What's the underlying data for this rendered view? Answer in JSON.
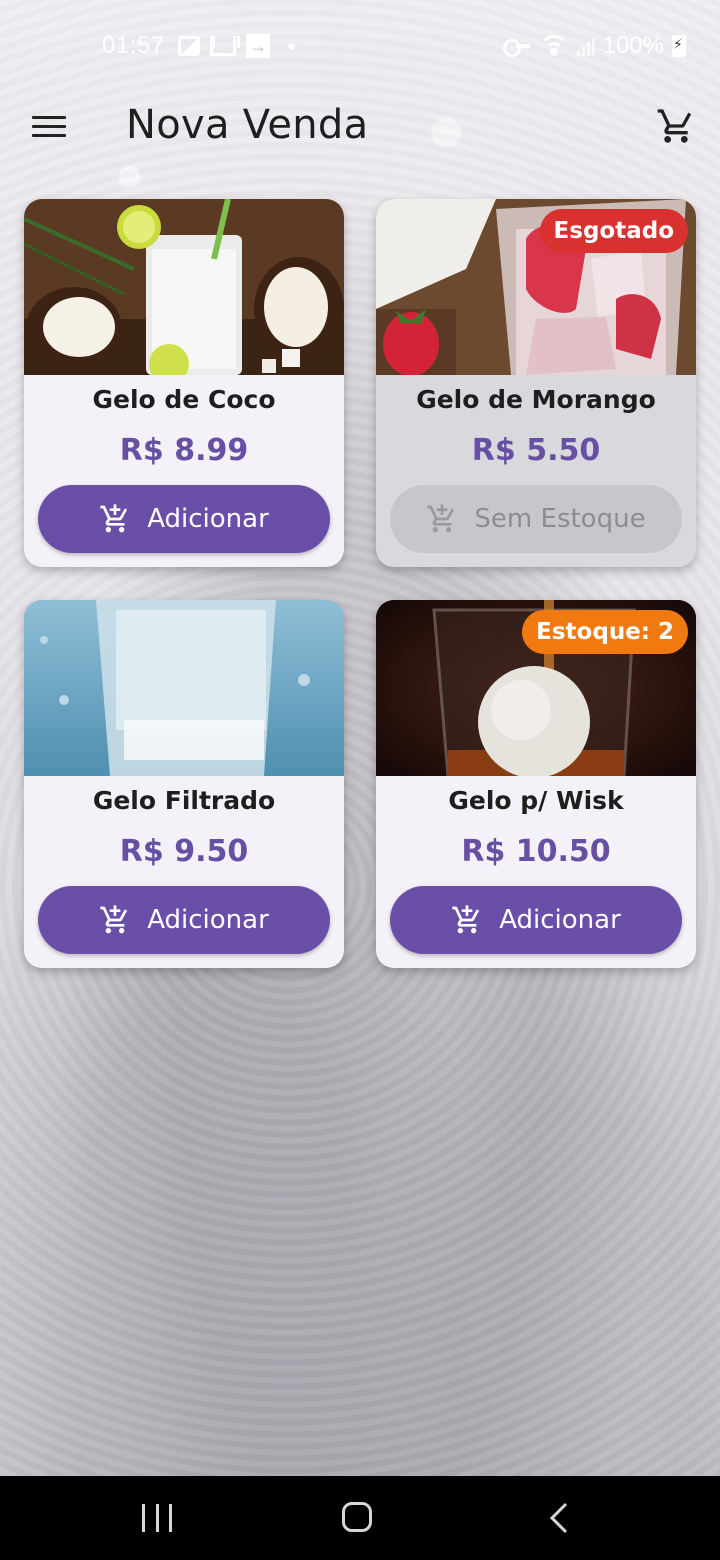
{
  "status_bar": {
    "time": "01:57",
    "battery": "100%"
  },
  "app_bar": {
    "title": "Nova Venda",
    "menu_icon": "menu-icon",
    "cart_icon": "shopping-cart-icon"
  },
  "products": [
    {
      "name": "Gelo de Coco",
      "price": "R$ 8.99",
      "button": "Adicionar",
      "badge": "",
      "available": true,
      "image": "coconut-drink"
    },
    {
      "name": "Gelo de Morango",
      "price": "R$ 5.50",
      "button": "Sem Estoque",
      "badge": "Esgotado",
      "available": false,
      "image": "strawberry-ice"
    },
    {
      "name": "Gelo Filtrado",
      "price": "R$ 9.50",
      "button": "Adicionar",
      "badge": "",
      "available": true,
      "image": "filtered-ice"
    },
    {
      "name": "Gelo p/ Wisk",
      "price": "R$ 10.50",
      "button": "Adicionar",
      "badge": "Estoque: 2",
      "available": true,
      "image": "whisky-ice-sphere"
    }
  ],
  "colors": {
    "primary": "#6a4fa8",
    "price": "#6750a4",
    "badge_out_of_stock": "#d93030",
    "badge_low_stock": "#f07a10"
  }
}
